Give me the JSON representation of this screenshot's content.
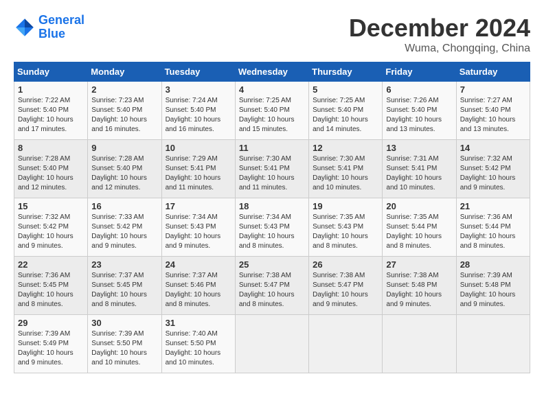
{
  "logo": {
    "line1": "General",
    "line2": "Blue"
  },
  "title": "December 2024",
  "subtitle": "Wuma, Chongqing, China",
  "weekdays": [
    "Sunday",
    "Monday",
    "Tuesday",
    "Wednesday",
    "Thursday",
    "Friday",
    "Saturday"
  ],
  "weeks": [
    [
      {
        "day": "1",
        "info": "Sunrise: 7:22 AM\nSunset: 5:40 PM\nDaylight: 10 hours and 17 minutes."
      },
      {
        "day": "2",
        "info": "Sunrise: 7:23 AM\nSunset: 5:40 PM\nDaylight: 10 hours and 16 minutes."
      },
      {
        "day": "3",
        "info": "Sunrise: 7:24 AM\nSunset: 5:40 PM\nDaylight: 10 hours and 16 minutes."
      },
      {
        "day": "4",
        "info": "Sunrise: 7:25 AM\nSunset: 5:40 PM\nDaylight: 10 hours and 15 minutes."
      },
      {
        "day": "5",
        "info": "Sunrise: 7:25 AM\nSunset: 5:40 PM\nDaylight: 10 hours and 14 minutes."
      },
      {
        "day": "6",
        "info": "Sunrise: 7:26 AM\nSunset: 5:40 PM\nDaylight: 10 hours and 13 minutes."
      },
      {
        "day": "7",
        "info": "Sunrise: 7:27 AM\nSunset: 5:40 PM\nDaylight: 10 hours and 13 minutes."
      }
    ],
    [
      {
        "day": "8",
        "info": "Sunrise: 7:28 AM\nSunset: 5:40 PM\nDaylight: 10 hours and 12 minutes."
      },
      {
        "day": "9",
        "info": "Sunrise: 7:28 AM\nSunset: 5:40 PM\nDaylight: 10 hours and 12 minutes."
      },
      {
        "day": "10",
        "info": "Sunrise: 7:29 AM\nSunset: 5:41 PM\nDaylight: 10 hours and 11 minutes."
      },
      {
        "day": "11",
        "info": "Sunrise: 7:30 AM\nSunset: 5:41 PM\nDaylight: 10 hours and 11 minutes."
      },
      {
        "day": "12",
        "info": "Sunrise: 7:30 AM\nSunset: 5:41 PM\nDaylight: 10 hours and 10 minutes."
      },
      {
        "day": "13",
        "info": "Sunrise: 7:31 AM\nSunset: 5:41 PM\nDaylight: 10 hours and 10 minutes."
      },
      {
        "day": "14",
        "info": "Sunrise: 7:32 AM\nSunset: 5:42 PM\nDaylight: 10 hours and 9 minutes."
      }
    ],
    [
      {
        "day": "15",
        "info": "Sunrise: 7:32 AM\nSunset: 5:42 PM\nDaylight: 10 hours and 9 minutes."
      },
      {
        "day": "16",
        "info": "Sunrise: 7:33 AM\nSunset: 5:42 PM\nDaylight: 10 hours and 9 minutes."
      },
      {
        "day": "17",
        "info": "Sunrise: 7:34 AM\nSunset: 5:43 PM\nDaylight: 10 hours and 9 minutes."
      },
      {
        "day": "18",
        "info": "Sunrise: 7:34 AM\nSunset: 5:43 PM\nDaylight: 10 hours and 8 minutes."
      },
      {
        "day": "19",
        "info": "Sunrise: 7:35 AM\nSunset: 5:43 PM\nDaylight: 10 hours and 8 minutes."
      },
      {
        "day": "20",
        "info": "Sunrise: 7:35 AM\nSunset: 5:44 PM\nDaylight: 10 hours and 8 minutes."
      },
      {
        "day": "21",
        "info": "Sunrise: 7:36 AM\nSunset: 5:44 PM\nDaylight: 10 hours and 8 minutes."
      }
    ],
    [
      {
        "day": "22",
        "info": "Sunrise: 7:36 AM\nSunset: 5:45 PM\nDaylight: 10 hours and 8 minutes."
      },
      {
        "day": "23",
        "info": "Sunrise: 7:37 AM\nSunset: 5:45 PM\nDaylight: 10 hours and 8 minutes."
      },
      {
        "day": "24",
        "info": "Sunrise: 7:37 AM\nSunset: 5:46 PM\nDaylight: 10 hours and 8 minutes."
      },
      {
        "day": "25",
        "info": "Sunrise: 7:38 AM\nSunset: 5:47 PM\nDaylight: 10 hours and 8 minutes."
      },
      {
        "day": "26",
        "info": "Sunrise: 7:38 AM\nSunset: 5:47 PM\nDaylight: 10 hours and 9 minutes."
      },
      {
        "day": "27",
        "info": "Sunrise: 7:38 AM\nSunset: 5:48 PM\nDaylight: 10 hours and 9 minutes."
      },
      {
        "day": "28",
        "info": "Sunrise: 7:39 AM\nSunset: 5:48 PM\nDaylight: 10 hours and 9 minutes."
      }
    ],
    [
      {
        "day": "29",
        "info": "Sunrise: 7:39 AM\nSunset: 5:49 PM\nDaylight: 10 hours and 9 minutes."
      },
      {
        "day": "30",
        "info": "Sunrise: 7:39 AM\nSunset: 5:50 PM\nDaylight: 10 hours and 10 minutes."
      },
      {
        "day": "31",
        "info": "Sunrise: 7:40 AM\nSunset: 5:50 PM\nDaylight: 10 hours and 10 minutes."
      },
      null,
      null,
      null,
      null
    ]
  ]
}
